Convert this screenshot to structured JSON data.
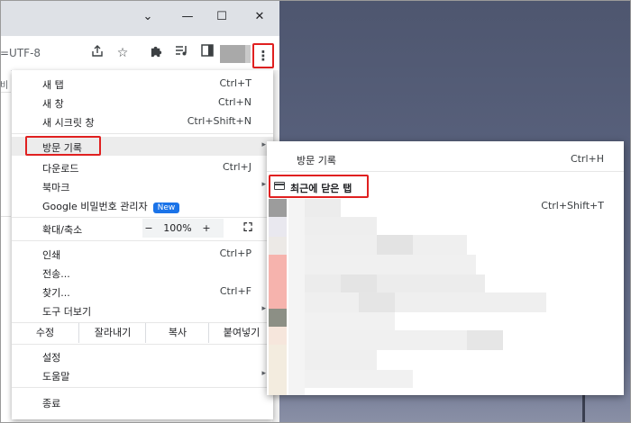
{
  "window": {
    "minimize_glyph": "—",
    "maximize_glyph": "☐",
    "close_glyph": "✕",
    "url_fragment": "=UTF-8",
    "left_page_fragment": "비"
  },
  "toolbar": {
    "share_icon": "share-icon",
    "bookmark_icon": "star-icon",
    "extensions_icon": "puzzle-icon",
    "media_icon": "media-queue-icon",
    "sidepanel_icon": "side-panel-icon",
    "menu_glyph": "⋮"
  },
  "menu": {
    "new_tab": {
      "label": "새 탭",
      "shortcut": "Ctrl+T"
    },
    "new_window": {
      "label": "새 창",
      "shortcut": "Ctrl+N"
    },
    "incognito": {
      "label": "새 시크릿 창",
      "shortcut": "Ctrl+Shift+N"
    },
    "history": {
      "label": "방문 기록"
    },
    "downloads": {
      "label": "다운로드",
      "shortcut": "Ctrl+J"
    },
    "bookmarks": {
      "label": "북마크"
    },
    "password_manager": {
      "label": "Google 비밀번호 관리자",
      "badge": "New"
    },
    "zoom": {
      "label": "확대/축소",
      "minus": "−",
      "value": "100%",
      "plus": "+",
      "fullscreen_glyph": "⛶"
    },
    "print": {
      "label": "인쇄",
      "shortcut": "Ctrl+P"
    },
    "cast": {
      "label": "전송..."
    },
    "find": {
      "label": "찾기...",
      "shortcut": "Ctrl+F"
    },
    "more_tools": {
      "label": "도구 더보기"
    },
    "edit": {
      "label": "수정",
      "cut": "잘라내기",
      "copy": "복사",
      "paste": "붙여넣기"
    },
    "settings": {
      "label": "설정"
    },
    "help": {
      "label": "도움말"
    },
    "exit": {
      "label": "종료"
    },
    "arrow_glyph": "▸"
  },
  "history_submenu": {
    "history": {
      "label": "방문 기록",
      "shortcut": "Ctrl+H"
    },
    "recently_closed": {
      "label": "최근에 닫은 탭"
    },
    "reopen_shortcut": "Ctrl+Shift+T"
  },
  "colors": {
    "highlight_red": "#e02020",
    "accent_blue": "#1a73e8",
    "menu_hover": "#ececec"
  }
}
